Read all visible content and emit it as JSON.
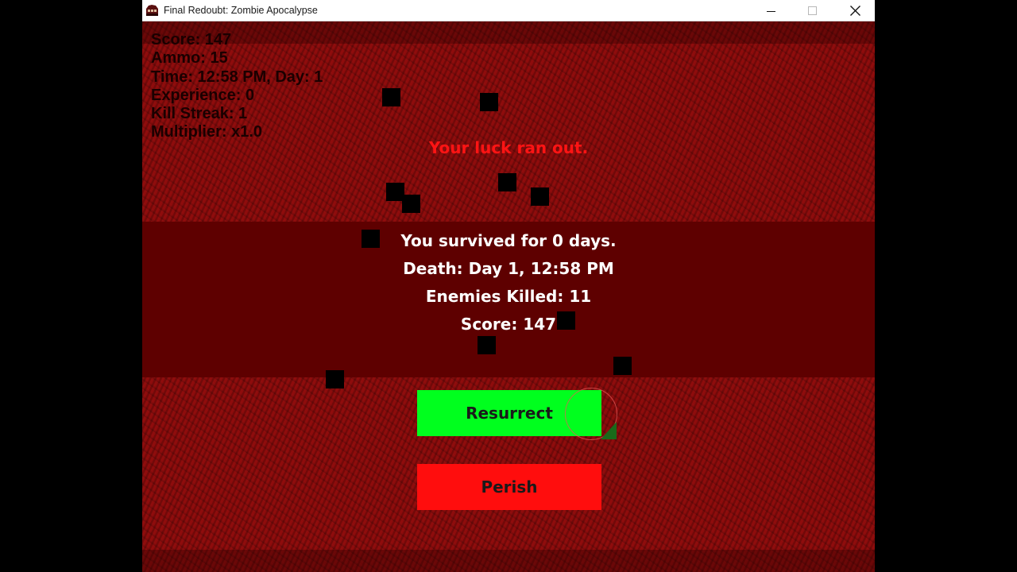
{
  "window": {
    "title": "Final Redoubt: Zombie Apocalypse",
    "icon": "game-app-icon",
    "controls": [
      "minimize-icon",
      "maximize-icon",
      "close-icon"
    ]
  },
  "hud": {
    "score": "Score: 147",
    "ammo": "Ammo: 15",
    "time": "Time: 12:58 PM, Day: 1",
    "experience": "Experience: 0",
    "kill_streak": "Kill Streak: 1",
    "multiplier": "Multiplier: x1.0"
  },
  "game_over": {
    "message": "Your luck ran out.",
    "survived": "You survived for 0 days.",
    "death": "Death: Day 1, 12:58 PM",
    "enemies_killed": "Enemies Killed: 11",
    "score": "Score: 147"
  },
  "buttons": {
    "resurrect": "Resurrect",
    "perish": "Perish"
  },
  "colors": {
    "background": "#8a0c0c",
    "message": "#ff1414",
    "resurrect": "#00ff1e",
    "perish": "#ff0d0d"
  }
}
